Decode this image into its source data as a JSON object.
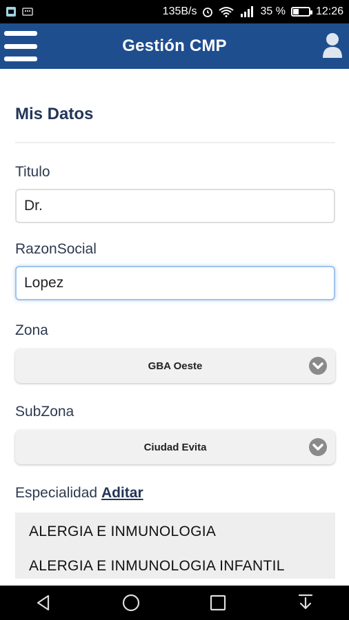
{
  "status_bar": {
    "speed": "135B/s",
    "battery_percent": "35 %",
    "battery_level": 0.35,
    "time": "12:26"
  },
  "app_bar": {
    "title": "Gestión CMP"
  },
  "form": {
    "section_title": "Mis Datos",
    "titulo_label": "Titulo",
    "titulo_value": "Dr.",
    "razon_label": "RazonSocial",
    "razon_value": "Lopez",
    "zona_label": "Zona",
    "zona_value": "GBA Oeste",
    "subzona_label": "SubZona",
    "subzona_value": "Ciudad Evita",
    "especialidad_label": "Especialidad",
    "especialidad_link": "Aditar",
    "especialidades": [
      "ALERGIA E INMUNOLOGIA",
      "ALERGIA E INMUNOLOGIA INFANTIL"
    ]
  },
  "colors": {
    "app_bar": "#1f4e8f",
    "title_text": "#233558"
  },
  "icons": [
    "menu-icon",
    "user-icon",
    "chevron-down-icon",
    "back-icon",
    "home-icon",
    "recents-icon",
    "download-icon"
  ]
}
